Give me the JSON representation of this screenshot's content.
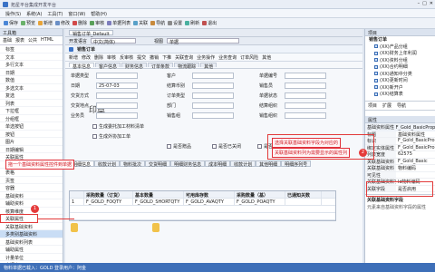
{
  "window": {
    "title": "拓星平台集成开发平台"
  },
  "menu": [
    "操作(S)",
    "系统(A)",
    "工具(T)",
    "窗口(W)",
    "帮助(H)"
  ],
  "toolbar": [
    "保存",
    "预览",
    "新增",
    "修改",
    "删除",
    "审核",
    "单据列表",
    "关联",
    "导航",
    "设置",
    "刷新",
    "退出"
  ],
  "left_panel": {
    "header": "工具箱",
    "tabs": [
      "基础",
      "报表",
      "公共",
      "HTML"
    ],
    "items": [
      "标签",
      "文本",
      "多行文本",
      "日期",
      "数值",
      "多选文本",
      "复选",
      "列表",
      "下拉框",
      "分组框",
      "单选按钮",
      "按钮",
      "图片",
      "日期编辑",
      "关联属性",
      "数据列",
      "表格",
      "页签",
      "容器",
      "基础资料",
      "辅助资料",
      "核算维度",
      "关联属性",
      "关联基础资料",
      "多类别基础资料",
      "基础资料列表",
      "辅助属性",
      "计量单位",
      "多语言"
    ],
    "selected_index": 24
  },
  "doc": {
    "tab": "销售订单_Default",
    "form_lang_label": "开发语言",
    "form_lang_value": "中文(简体)",
    "view_label": "视图",
    "view_value": "单据",
    "form_title": "销售订单",
    "row_tools": [
      "新增",
      "修改",
      "删除",
      "审核",
      "反审核",
      "提交",
      "撤销",
      "下推",
      "关联查询",
      "业务操作",
      "业务查询",
      "订单风险",
      "其他"
    ],
    "tabs": [
      "基本信息",
      "客户信息",
      "财务信息",
      "订单条款",
      "物流跟踪",
      "其他"
    ],
    "stamp": "印章",
    "fields": [
      {
        "label": "单据类型",
        "value": ""
      },
      {
        "label": "日期",
        "value": "25-07-03"
      },
      {
        "label": "交货方式",
        "value": ""
      },
      {
        "label": "交货地点",
        "value": ""
      },
      {
        "label": "业务员",
        "value": ""
      },
      {
        "label": "客户",
        "value": ""
      },
      {
        "label": "结算币别",
        "value": ""
      },
      {
        "label": "订单类型",
        "value": ""
      },
      {
        "label": "部门",
        "value": ""
      },
      {
        "label": "销售组",
        "value": ""
      },
      {
        "label": "单据编号",
        "value": ""
      },
      {
        "label": "销售员",
        "value": ""
      },
      {
        "label": "单据状态",
        "value": ""
      },
      {
        "label": "结算组织",
        "value": ""
      },
      {
        "label": "销售组织",
        "value": ""
      }
    ],
    "checks": [
      "生成委托加工材料清单",
      "生成外协加工单",
      "是否赠品",
      "是否已关闭",
      "是否折扣"
    ],
    "grid_tabs": [
      "明细信息",
      "收款计划",
      "物料批次",
      "交货明细",
      "明细财务信息",
      "成本明细",
      "收款计划",
      "其他明细",
      "明细序列号"
    ],
    "grid_headers": [
      "采购数量（订货）",
      "基本数量",
      "可用库存数",
      "采购数量（基）",
      "已通知关数"
    ],
    "grid_row": [
      "F_GOLD_FOQTY",
      "F_GOLD_SHORTQTY",
      "F_GOLD_AVAQTY",
      "F_GOLD_POAQTY",
      ""
    ],
    "row_number": "1"
  },
  "right_panel": {
    "header": "项目",
    "tree_root": "销售订单",
    "tree_items": [
      "(XX)产品分组",
      "(XX)财务上年利润",
      "(XX)资料分组",
      "(XX)合约明细",
      "(XX)通知中分类",
      "(XX)更新时间",
      "(XX)新开户",
      "(XX)结算表"
    ],
    "tabs": [
      "项目",
      "扩展",
      "导航"
    ],
    "props_header": "属性",
    "props_title": "基础资料属性 F_Gold_BasicProperty",
    "props": [
      {
        "k": "标题",
        "v": "基础资料属性"
      },
      {
        "k": "标识",
        "v": "F_Gold_BasicPro"
      },
      {
        "k": "绑定实体属性",
        "v": "F_Gold_BasicPro"
      },
      {
        "k": "列表宽度",
        "v": "62575"
      },
      {
        "k": "关联基础资料",
        "v": "F_Gold_Basic"
      },
      {
        "k": "关联基础资料",
        "v": "物料编码"
      },
      {
        "k": "可见性",
        "v": ""
      },
      {
        "k": "关联基础资料字段",
        "v": "Id物料编码"
      },
      {
        "k": "关联字段",
        "v": "是否启用"
      }
    ],
    "help_title": "关联基础资料字段",
    "help_text": "元素来自基础资料字段的属性"
  },
  "annotations": {
    "left_note": "拖一个基础资料属性控件到单据",
    "right_note_1": "选择关联基础资料字段为对应的",
    "right_note_2": "关联基础资料列为需要显示的属性列",
    "dot1": "1",
    "dot2": "2"
  },
  "status": {
    "text": "物料单据已载入：GOLD 登录用户：阿金"
  }
}
